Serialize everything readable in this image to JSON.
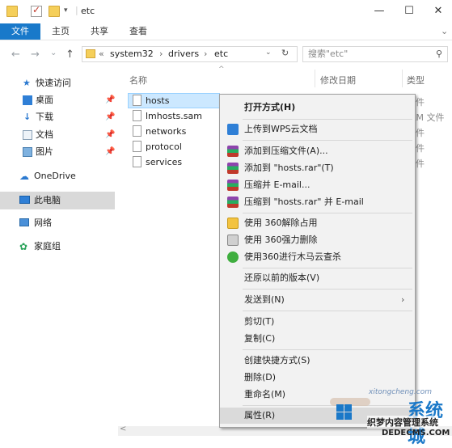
{
  "window": {
    "title": "etc",
    "minimize": "—",
    "maximize": "☐",
    "close": "✕"
  },
  "ribbon": {
    "file": "文件",
    "home": "主页",
    "share": "共享",
    "view": "查看",
    "expand": "⌄"
  },
  "nav": {
    "back": "←",
    "forward": "→",
    "recent": "⌄",
    "up": "↑",
    "breadcrumb": [
      "system32",
      "drivers",
      "etc"
    ],
    "breadcrumb_prefix": "«",
    "search_placeholder": "搜索\"etc\""
  },
  "sidebar": {
    "quick_access": "快速访问",
    "items": [
      "桌面",
      "下载",
      "文档",
      "图片"
    ],
    "onedrive": "OneDrive",
    "this_pc": "此电脑",
    "network": "网络",
    "homegroup": "家庭组"
  },
  "list": {
    "columns": {
      "name": "名称",
      "modified": "修改日期",
      "type": "类型"
    },
    "files": [
      "hosts",
      "lmhosts.sam",
      "networks",
      "protocol",
      "services"
    ],
    "type_fragments": [
      "件",
      "AM 文件",
      "件",
      "件",
      "件"
    ]
  },
  "context_menu": {
    "open_with": "打开方式(H)",
    "upload_wps": "上传到WPS云文档",
    "add_archive": "添加到压缩文件(A)...",
    "add_hosts_rar": "添加到 \"hosts.rar\"(T)",
    "compress_email": "压缩并 E-mail...",
    "compress_hosts_email": "压缩到 \"hosts.rar\" 并 E-mail",
    "unlock_360": "使用 360解除占用",
    "delete_360": "使用 360强力删除",
    "scan_360": "使用360进行木马云查杀",
    "restore": "还原以前的版本(V)",
    "send_to": "发送到(N)",
    "cut": "剪切(T)",
    "copy": "复制(C)",
    "create_shortcut": "创建快捷方式(S)",
    "delete": "删除(D)",
    "rename": "重命名(M)",
    "properties": "属性(R)"
  },
  "watermark": {
    "site": "xitongcheng.com",
    "brand": "系统城",
    "dede": "织梦内容管理系统",
    "dedecms": "DEDECMS.COM"
  },
  "colors": {
    "accent": "#1979ca"
  }
}
